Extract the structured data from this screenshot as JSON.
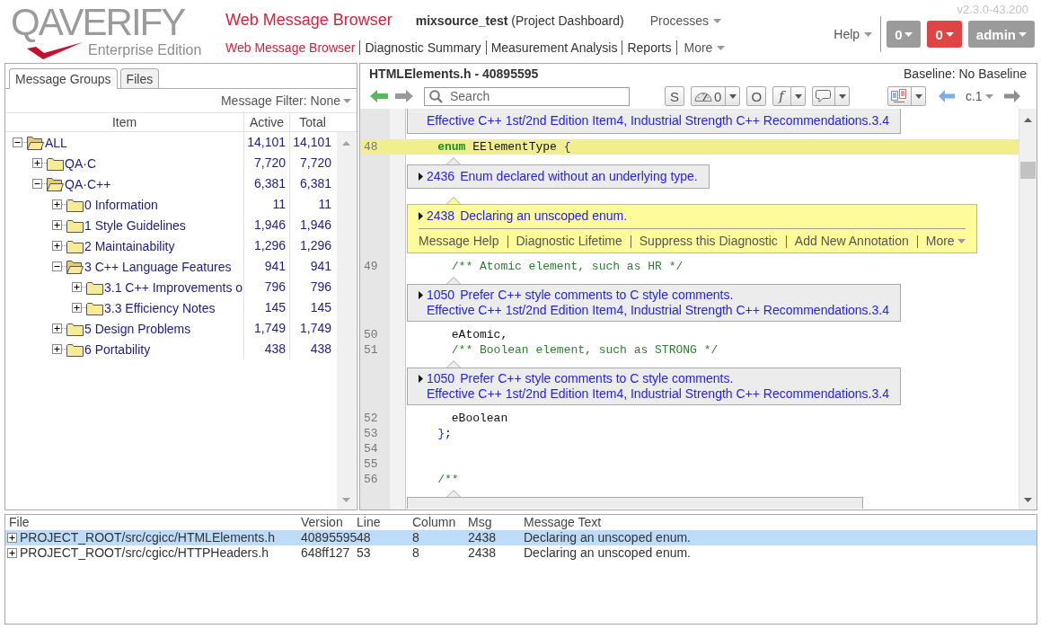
{
  "header": {
    "logo": {
      "wordmark": "QAVERIFY",
      "edition": "Enterprise Edition"
    },
    "app_title": "Web Message Browser",
    "project": "**mixsource_test** (Project Dashboard)",
    "processes_menu": "Processes",
    "version": "v2.3.0-43.200",
    "help_menu": "Help",
    "user_buttons": [
      {
        "label": "0",
        "kind": "neutral"
      },
      {
        "label": "0",
        "kind": "alert"
      },
      {
        "label": "admin",
        "kind": "neutral"
      }
    ],
    "nav": [
      {
        "label": "Web Message Browser",
        "selected": true
      },
      {
        "label": "Diagnostic Summary",
        "selected": false
      },
      {
        "label": "Measurement Analysis",
        "selected": false
      },
      {
        "label": "Reports",
        "selected": false
      }
    ],
    "nav_more": "More"
  },
  "left_panel": {
    "tabs": [
      {
        "label": "Message Groups",
        "selected": true
      },
      {
        "label": "Files",
        "selected": false
      }
    ],
    "filter": "Message Filter: None",
    "columns": [
      "Item",
      "Active",
      "Total"
    ],
    "tree": [
      {
        "label": "ALL",
        "active": "14,101",
        "total": "14,101",
        "expanded": true,
        "children": [
          {
            "label": "QA·C",
            "active": "7,720",
            "total": "7,720",
            "expanded": false
          },
          {
            "label": "QA·C++",
            "active": "6,381",
            "total": "6,381",
            "expanded": true,
            "children": [
              {
                "label": "0 Information",
                "active": "11",
                "total": "11",
                "expanded": false
              },
              {
                "label": "1 Style Guidelines",
                "active": "1,946",
                "total": "1,946",
                "expanded": false
              },
              {
                "label": "2 Maintainability",
                "active": "1,296",
                "total": "1,296",
                "expanded": false
              },
              {
                "label": "3 C++ Language Features",
                "active": "941",
                "total": "941",
                "expanded": true,
                "children": [
                  {
                    "label": "3.1 C++ Improvements o",
                    "active": "796",
                    "total": "796",
                    "expanded": false
                  },
                  {
                    "label": "3.3 Efficiency Notes",
                    "active": "145",
                    "total": "145",
                    "expanded": false
                  }
                ]
              },
              {
                "label": "5 Design Problems",
                "active": "1,749",
                "total": "1,749",
                "expanded": false
              },
              {
                "label": "6 Portability",
                "active": "438",
                "total": "438",
                "expanded": false
              }
            ]
          }
        ]
      }
    ]
  },
  "editor": {
    "file_title": "HTMLElements.h - 40895595",
    "baseline": "Baseline: No Baseline",
    "history": {
      "back_enabled": true,
      "forward_enabled": false
    },
    "search": {
      "placeholder": "Search"
    },
    "tools": [
      {
        "kind": "letter",
        "label": "S",
        "has_menu": false
      },
      {
        "kind": "gauge",
        "label": "0",
        "has_menu": true
      },
      {
        "kind": "letter",
        "label": "O",
        "has_menu": false
      },
      {
        "kind": "function",
        "label": "f",
        "has_menu": true
      },
      {
        "kind": "comment",
        "has_menu": true
      }
    ],
    "view_tools": [
      {
        "kind": "compare",
        "has_menu": true
      }
    ],
    "diagnostic_nav": {
      "previous_enabled": true,
      "next_enabled": false
    },
    "context": "c.1",
    "code": [
      {
        "kind": "message_tail",
        "reference": "Effective C++ 1st/2nd Edition Item4, Industrial Strength C++ Recommendations.3.4",
        "selected": false
      },
      {
        "kind": "line",
        "number": "48",
        "selected": true,
        "tokens": [
          {
            "kind": "keyword",
            "text": "    enum"
          },
          {
            "kind": "plain",
            "text": " EElementType "
          },
          {
            "kind": "punct",
            "text": "{"
          }
        ]
      },
      {
        "kind": "message",
        "number": "2436",
        "text": "Enum declared without an underlying type.",
        "selected": false
      },
      {
        "kind": "message",
        "number": "2438",
        "text": "Declaring an unscoped enum.",
        "selected": true,
        "actions": [
          {
            "label": "Message Help",
            "kind": "link"
          },
          {
            "label": "Diagnostic Lifetime",
            "kind": "link"
          },
          {
            "label": "Suppress this Diagnostic",
            "kind": "link"
          },
          {
            "label": "Add New Annotation",
            "kind": "link"
          },
          {
            "label": "More",
            "kind": "menu"
          }
        ]
      },
      {
        "kind": "line",
        "number": "49",
        "selected": false,
        "tokens": [
          {
            "kind": "comment",
            "text": "      /** Atomic element, such as HR */"
          }
        ]
      },
      {
        "kind": "message",
        "number": "1050",
        "text": "Prefer C++ style comments to C style comments.",
        "reference": "Effective C++ 1st/2nd Edition Item4, Industrial Strength C++ Recommendations.3.4",
        "selected": false
      },
      {
        "kind": "line",
        "number": "50",
        "selected": false,
        "tokens": [
          {
            "kind": "plain",
            "text": "      eAtomic,"
          }
        ]
      },
      {
        "kind": "line",
        "number": "51",
        "selected": false,
        "tokens": [
          {
            "kind": "comment",
            "text": "      /** Boolean element, such as STRONG */"
          }
        ]
      },
      {
        "kind": "message",
        "number": "1050",
        "text": "Prefer C++ style comments to C style comments.",
        "reference": "Effective C++ 1st/2nd Edition Item4, Industrial Strength C++ Recommendations.3.4",
        "selected": false
      },
      {
        "kind": "line",
        "number": "52",
        "selected": false,
        "tokens": [
          {
            "kind": "plain",
            "text": "      eBoolean"
          }
        ]
      },
      {
        "kind": "line",
        "number": "53",
        "selected": false,
        "tokens": [
          {
            "kind": "punct",
            "text": "    }"
          },
          {
            "kind": "plain",
            "text": ";"
          }
        ]
      },
      {
        "kind": "line",
        "number": "54",
        "selected": false
      },
      {
        "kind": "line",
        "number": "55",
        "selected": false
      },
      {
        "kind": "line",
        "number": "56",
        "selected": false,
        "tokens": [
          {
            "kind": "comment",
            "text": "    /**"
          }
        ]
      },
      {
        "kind": "message_head",
        "selected": false
      }
    ]
  },
  "results_table": {
    "columns": [
      "File",
      "Version",
      "Line",
      "Column",
      "Msg",
      "Message Text"
    ],
    "rows": [
      {
        "file": "PROJECT_ROOT/src/cgicc/HTMLElements.h",
        "version": "40895595",
        "line": "48",
        "column": "8",
        "msg": "2438",
        "message_text": "Declaring an unscoped enum.",
        "expanded": false,
        "selected": true
      },
      {
        "file": "PROJECT_ROOT/src/cgicc/HTTPHeaders.h",
        "version": "648ff127",
        "line": "53",
        "column": "8",
        "msg": "2438",
        "message_text": "Declaring an unscoped enum.",
        "expanded": false,
        "selected": false
      }
    ]
  }
}
